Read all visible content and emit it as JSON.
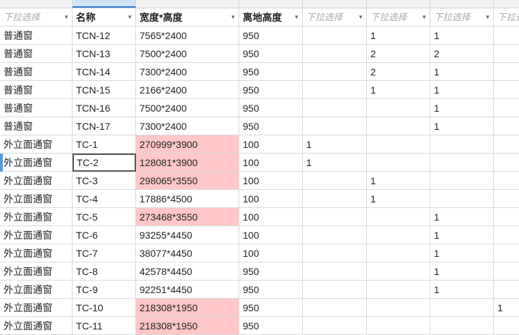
{
  "header": [
    "下拉选择",
    "名称",
    "宽度*高度",
    "离地高度",
    "下拉选择",
    "下拉选择",
    "下拉选择",
    "下拉选"
  ],
  "header_placeholder": [
    true,
    false,
    false,
    false,
    true,
    true,
    true,
    true
  ],
  "rows": [
    [
      "普通窗",
      "TCN-12",
      "7565*2400",
      "950",
      "",
      "1",
      "1",
      ""
    ],
    [
      "普通窗",
      "TCN-13",
      "7500*2400",
      "950",
      "",
      "2",
      "2",
      ""
    ],
    [
      "普通窗",
      "TCN-14",
      "7300*2400",
      "950",
      "",
      "2",
      "1",
      ""
    ],
    [
      "普通窗",
      "TCN-15",
      "2166*2400",
      "950",
      "",
      "1",
      "1",
      ""
    ],
    [
      "普通窗",
      "TCN-16",
      "7500*2400",
      "950",
      "",
      "",
      "1",
      ""
    ],
    [
      "普通窗",
      "TCN-17",
      "7300*2400",
      "950",
      "",
      "",
      "1",
      ""
    ],
    [
      "外立面通窗",
      "TC-1",
      "270999*3900",
      "100",
      "1",
      "",
      "",
      ""
    ],
    [
      "外立面通窗",
      "TC-2",
      "128081*3900",
      "100",
      "1",
      "",
      "",
      ""
    ],
    [
      "外立面通窗",
      "TC-3",
      "298065*3550",
      "100",
      "",
      "1",
      "",
      ""
    ],
    [
      "外立面通窗",
      "TC-4",
      "17886*4500",
      "100",
      "",
      "1",
      "",
      ""
    ],
    [
      "外立面通窗",
      "TC-5",
      "273468*3550",
      "100",
      "",
      "",
      "1",
      ""
    ],
    [
      "外立面通窗",
      "TC-6",
      "93255*4450",
      "100",
      "",
      "",
      "1",
      ""
    ],
    [
      "外立面通窗",
      "TC-7",
      "38077*4450",
      "100",
      "",
      "",
      "1",
      ""
    ],
    [
      "外立面通窗",
      "TC-8",
      "42578*4450",
      "950",
      "",
      "",
      "1",
      ""
    ],
    [
      "外立面通窗",
      "TC-9",
      "92251*4450",
      "950",
      "",
      "",
      "1",
      ""
    ],
    [
      "外立面通窗",
      "TC-10",
      "218308*1950",
      "950",
      "",
      "",
      "",
      "1"
    ],
    [
      "外立面通窗",
      "TC-11",
      "218308*1950",
      "950",
      "",
      "",
      "",
      ""
    ]
  ],
  "highlight_rows": [
    6,
    7,
    8,
    10,
    15,
    16
  ],
  "highlight_color": "#ffc7c7",
  "active_cell": {
    "row": 7,
    "col": 1
  },
  "dropdown_icon": "triangle-down"
}
